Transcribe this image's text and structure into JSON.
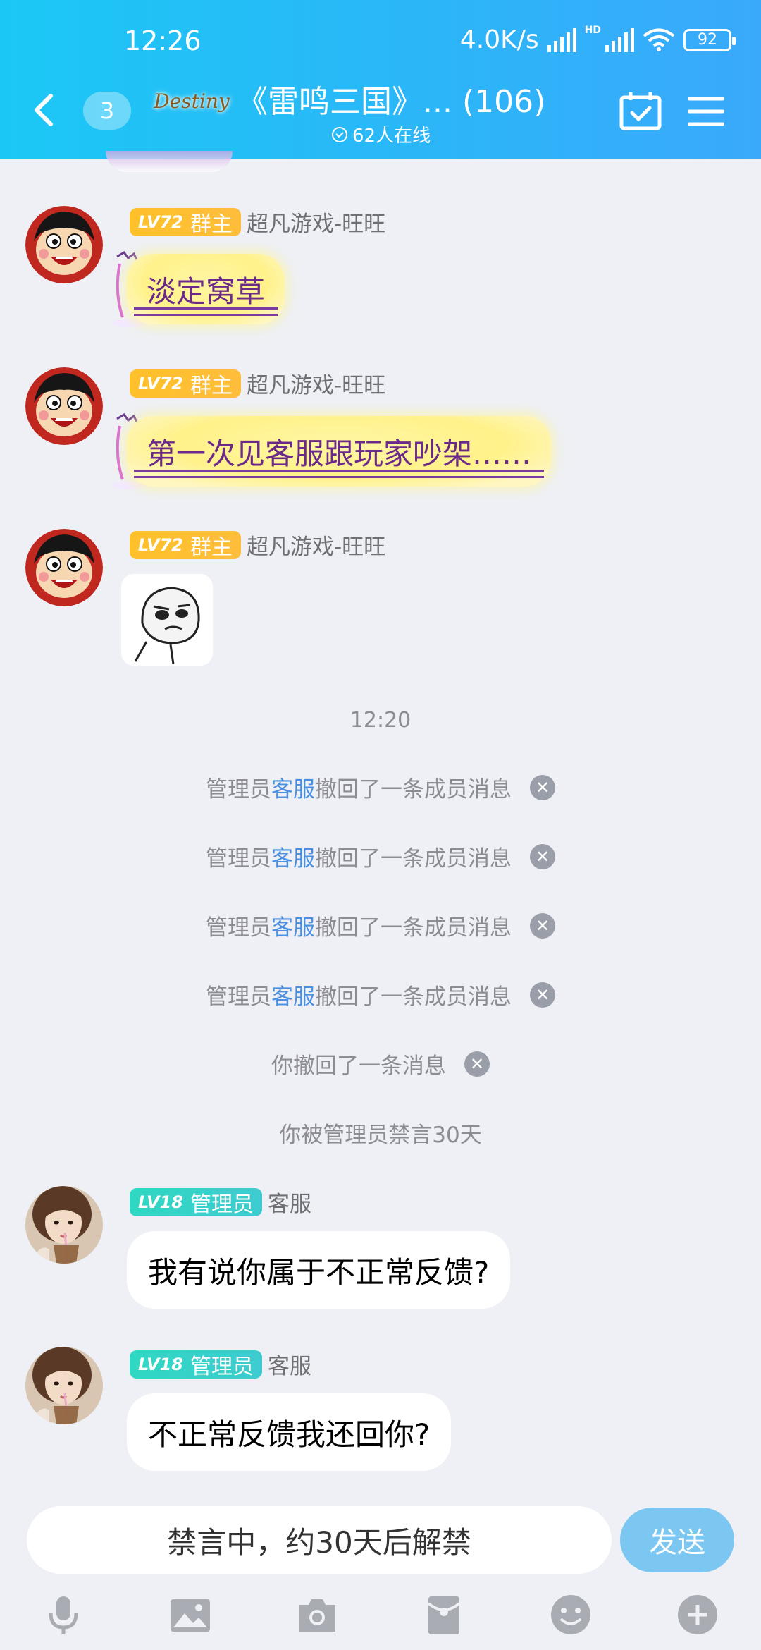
{
  "status_bar": {
    "time": "12:26",
    "speed": "4.0K/s",
    "hd": "HD",
    "battery": "92"
  },
  "header": {
    "back_icon": "chevron-left-icon",
    "unread_count": "3",
    "group_logo_text": "Destiny",
    "title": "《雷鸣三国》... (106)",
    "online_text": "62人在线",
    "calendar_icon": "calendar-check-icon",
    "menu_icon": "hamburger-menu-icon",
    "gradient_start": "#1bc8f5",
    "gradient_end": "#3aa9fa"
  },
  "messages": [
    {
      "level": "LV72",
      "role": "群主",
      "nickname": "超凡游戏-旺旺",
      "text": "淡定窝草"
    },
    {
      "level": "LV72",
      "role": "群主",
      "nickname": "超凡游戏-旺旺",
      "text": "第一次见客服跟玩家吵架……"
    },
    {
      "level": "LV72",
      "role": "群主",
      "nickname": "超凡游戏-旺旺",
      "sticker": "shy-face-sticker"
    },
    {
      "level": "LV18",
      "role": "管理员",
      "nickname": "客服",
      "text": "我有说你属于不正常反馈?"
    },
    {
      "level": "LV18",
      "role": "管理员",
      "nickname": "客服",
      "text": "不正常反馈我还回你?"
    }
  ],
  "timestamp": "12:20",
  "system_notices": [
    {
      "before": "管理员",
      "highlight": "客服",
      "after": "撤回了一条成员消息"
    },
    {
      "before": "管理员",
      "highlight": "客服",
      "after": "撤回了一条成员消息"
    },
    {
      "before": "管理员",
      "highlight": "客服",
      "after": "撤回了一条成员消息"
    },
    {
      "before": "管理员",
      "highlight": "客服",
      "after": "撤回了一条成员消息"
    },
    {
      "before": "你撤回了一条消息"
    },
    {
      "before": "你被管理员禁言30天"
    }
  ],
  "input": {
    "muted_text": "禁言中，约30天后解禁",
    "send_label": "发送"
  },
  "toolbar": [
    "microphone-icon",
    "image-icon",
    "camera-icon",
    "red-packet-icon",
    "emoji-icon",
    "plus-icon"
  ]
}
